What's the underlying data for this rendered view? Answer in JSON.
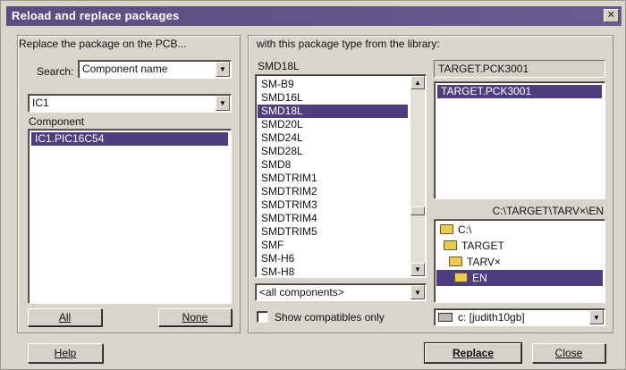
{
  "window": {
    "title": "Reload and replace packages",
    "close_glyph": "✕"
  },
  "left_panel": {
    "heading": "Replace the package on the PCB...",
    "search_label": "Search:",
    "search_mode": "Component name",
    "name_value": "IC1",
    "component_label": "Component",
    "components": [
      "IC1.PIC16C54"
    ],
    "all_button": "All",
    "none_button": "None"
  },
  "right_panel": {
    "heading": "with this package type from the library:",
    "package_current": "SMD18L",
    "packages": [
      "SM-B9",
      "SMD16L",
      "SMD18L",
      "SMD20L",
      "SMD24L",
      "SMD28L",
      "SMD8",
      "SMDTRIM1",
      "SMDTRIM2",
      "SMDTRIM3",
      "SMDTRIM4",
      "SMDTRIM5",
      "SMF",
      "SM-H6",
      "SM-H8"
    ],
    "selected_package": "SMD18L",
    "filter_value": "<all components>",
    "show_compatibles_label": "Show compatibles only",
    "show_compatibles_checked": false,
    "library_current": "TARGET.PCK3001",
    "libraries": [
      "TARGET.PCK3001"
    ],
    "path": "C:\\TARGET\\TARV×\\EN",
    "folders": [
      "C:\\",
      "TARGET",
      "TARV×",
      "EN"
    ],
    "drive": "c: [judith10gb]"
  },
  "footer": {
    "help_button": "Help",
    "replace_button": "Replace",
    "close_button": "Close"
  },
  "icons": {
    "folder": "folder-icon",
    "drive": "drive-icon",
    "dropdown": "chevron-down-icon"
  },
  "colors": {
    "titlebar": "#5a4d80",
    "selection": "#4d3f7e",
    "face": "#d9d5cd"
  }
}
